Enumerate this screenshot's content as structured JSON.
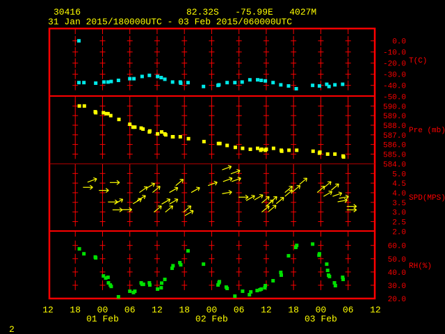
{
  "header": {
    "station": "30416",
    "location": "82.32S   -75.99E   4027M",
    "period": "31 Jan 2015/180000UTC - 03 Feb 2015/060000UTC"
  },
  "footer": {
    "page": "2"
  },
  "colors": {
    "frame": "#ff0000",
    "temperature": "#00e8e8",
    "pressure": "#ffff00",
    "wind": "#ffff00",
    "rh": "#00e000",
    "text": "#ffff00"
  },
  "chart_data": [
    {
      "type": "scatter",
      "title": "Temperature",
      "ylabel": "T(C)",
      "ylim": [
        -50,
        0
      ],
      "yticks": [
        "0.0",
        "-10.0",
        "-20.0",
        "-30.0",
        "-40.0",
        "-50.0"
      ],
      "ytick_values": [
        0,
        -10,
        -20,
        -30,
        -40,
        -50
      ],
      "x_units": "hours since 31 Jan 2015 12UTC",
      "points": [
        [
          6.8,
          0.0
        ],
        [
          6.8,
          -37.5
        ],
        [
          7.9,
          -37.5
        ],
        [
          10.5,
          -38
        ],
        [
          12.3,
          -37
        ],
        [
          13.2,
          -37
        ],
        [
          13.9,
          -36.5
        ],
        [
          15.5,
          -35.5
        ],
        [
          18.0,
          -34
        ],
        [
          18.9,
          -34
        ],
        [
          20.7,
          -32
        ],
        [
          22.3,
          -31
        ],
        [
          24.1,
          -32
        ],
        [
          24.9,
          -33
        ],
        [
          25.7,
          -34.5
        ],
        [
          27.4,
          -37
        ],
        [
          29.1,
          -37
        ],
        [
          29.2,
          -38
        ],
        [
          30.8,
          -37.5
        ],
        [
          34.2,
          -41
        ],
        [
          37.4,
          -40
        ],
        [
          37.6,
          -39.5
        ],
        [
          39.4,
          -37.5
        ],
        [
          41.1,
          -37.5
        ],
        [
          42.7,
          -37
        ],
        [
          44.4,
          -35
        ],
        [
          46.1,
          -35
        ],
        [
          46.9,
          -35.5
        ],
        [
          47.8,
          -36
        ],
        [
          49.5,
          -37.5
        ],
        [
          51.2,
          -39.5
        ],
        [
          52.9,
          -40.5
        ],
        [
          54.6,
          -43
        ],
        [
          58.2,
          -40
        ],
        [
          59.7,
          -40.5
        ],
        [
          61.3,
          -39
        ],
        [
          61.8,
          -41
        ],
        [
          63.1,
          -39.5
        ],
        [
          64.8,
          -39
        ]
      ]
    },
    {
      "type": "scatter",
      "title": "Pressure",
      "ylabel": "Pre (mb)",
      "ylim": [
        584,
        590
      ],
      "yticks": [
        "590.0",
        "589.0",
        "588.0",
        "587.0",
        "586.0",
        "585.0",
        "584.0"
      ],
      "ytick_values": [
        590,
        589,
        588,
        587,
        586,
        585,
        584
      ],
      "points": [
        [
          6.9,
          590.0
        ],
        [
          8.0,
          590.0
        ],
        [
          10.4,
          589.4
        ],
        [
          10.5,
          589.3
        ],
        [
          12.2,
          589.3
        ],
        [
          12.8,
          589.2
        ],
        [
          13.2,
          589.2
        ],
        [
          13.8,
          589.0
        ],
        [
          15.6,
          588.6
        ],
        [
          18.0,
          588.1
        ],
        [
          18.7,
          587.8
        ],
        [
          19.1,
          587.8
        ],
        [
          20.5,
          587.7
        ],
        [
          20.9,
          587.6
        ],
        [
          22.4,
          587.4
        ],
        [
          22.3,
          587.3
        ],
        [
          24.1,
          587.1
        ],
        [
          25.0,
          587.3
        ],
        [
          25.7,
          587.1
        ],
        [
          25.9,
          587.0
        ],
        [
          27.4,
          586.8
        ],
        [
          27.5,
          586.8
        ],
        [
          29.1,
          586.8
        ],
        [
          30.9,
          586.6
        ],
        [
          34.3,
          586.3
        ],
        [
          37.5,
          586.1
        ],
        [
          37.8,
          586.1
        ],
        [
          39.4,
          585.9
        ],
        [
          41.2,
          585.7
        ],
        [
          42.8,
          585.6
        ],
        [
          44.5,
          585.5
        ],
        [
          46.1,
          585.6
        ],
        [
          46.8,
          585.4
        ],
        [
          47.0,
          585.5
        ],
        [
          47.8,
          585.4
        ],
        [
          48.0,
          585.5
        ],
        [
          49.6,
          585.6
        ],
        [
          51.3,
          585.4
        ],
        [
          51.4,
          585.3
        ],
        [
          53.0,
          585.4
        ],
        [
          54.7,
          585.4
        ],
        [
          58.3,
          585.3
        ],
        [
          59.7,
          585.1
        ],
        [
          59.8,
          585.2
        ],
        [
          61.5,
          585.0
        ],
        [
          63.1,
          585.0
        ],
        [
          64.9,
          584.8
        ],
        [
          65.0,
          584.7
        ]
      ]
    },
    {
      "type": "scatter",
      "title": "Wind speed and direction",
      "ylabel": "SPD(MPS)",
      "ylim": [
        2.0,
        5.0
      ],
      "yticks": [
        "5.0",
        "4.5",
        "4.0",
        "3.5",
        "3.0",
        "2.5",
        "2.0"
      ],
      "ytick_values": [
        5.0,
        4.5,
        4.0,
        3.5,
        3.0,
        2.5,
        2.0
      ],
      "points_hour_speed_angle": [
        [
          7.7,
          4.28,
          0
        ],
        [
          8.7,
          4.55,
          20
        ],
        [
          13.6,
          4.53,
          0
        ],
        [
          11.2,
          4.12,
          0
        ],
        [
          13.2,
          3.52,
          0
        ],
        [
          14.6,
          3.41,
          30
        ],
        [
          14.2,
          3.11,
          0
        ],
        [
          16.3,
          3.12,
          0
        ],
        [
          18.7,
          3.43,
          30
        ],
        [
          19.6,
          3.59,
          30
        ],
        [
          20.1,
          4.01,
          35
        ],
        [
          21.6,
          4.23,
          30
        ],
        [
          23.0,
          4.01,
          40
        ],
        [
          23.3,
          2.99,
          40
        ],
        [
          25.0,
          3.41,
          30
        ],
        [
          26.7,
          3.41,
          30
        ],
        [
          25.8,
          2.99,
          40
        ],
        [
          26.7,
          4.01,
          30
        ],
        [
          28.1,
          4.37,
          40
        ],
        [
          29.8,
          2.99,
          40
        ],
        [
          30.1,
          2.81,
          30
        ],
        [
          31.5,
          4.01,
          30
        ],
        [
          35.2,
          4.37,
          20
        ],
        [
          38.3,
          5.19,
          20
        ],
        [
          40.2,
          4.98,
          20
        ],
        [
          38.5,
          4.58,
          20
        ],
        [
          40.4,
          4.58,
          20
        ],
        [
          38.3,
          3.95,
          10
        ],
        [
          41.9,
          3.77,
          0
        ],
        [
          43.6,
          3.59,
          30
        ],
        [
          45.4,
          3.63,
          30
        ],
        [
          47.0,
          3.47,
          40
        ],
        [
          47.9,
          3.29,
          40
        ],
        [
          47.0,
          2.99,
          40
        ],
        [
          48.5,
          3.02,
          40
        ],
        [
          48.7,
          3.47,
          40
        ],
        [
          50.2,
          3.43,
          40
        ],
        [
          52.1,
          4.01,
          40
        ],
        [
          52.1,
          3.81,
          40
        ],
        [
          53.8,
          4.05,
          40
        ],
        [
          55.3,
          4.43,
          40
        ],
        [
          59.2,
          4.01,
          40
        ],
        [
          60.6,
          4.25,
          40
        ],
        [
          60.6,
          3.81,
          30
        ],
        [
          62.3,
          4.13,
          40
        ],
        [
          62.6,
          3.81,
          20
        ],
        [
          64.0,
          3.71,
          10
        ],
        [
          63.7,
          3.53,
          10
        ],
        [
          65.7,
          3.29,
          0
        ],
        [
          65.7,
          3.11,
          0
        ]
      ]
    },
    {
      "type": "scatter",
      "title": "Relative humidity",
      "ylabel": "RH(%)",
      "ylim": [
        20,
        60
      ],
      "yticks": [
        "60.0",
        "50.0",
        "40.0",
        "30.0",
        "20.0"
      ],
      "ytick_values": [
        60,
        50,
        40,
        30,
        20
      ],
      "points": [
        [
          6.9,
          57.4
        ],
        [
          7.9,
          53.7
        ],
        [
          10.4,
          51.3
        ],
        [
          10.5,
          50.6
        ],
        [
          12.2,
          37.0
        ],
        [
          12.7,
          35.4
        ],
        [
          13.2,
          36.0
        ],
        [
          13.3,
          31.8
        ],
        [
          13.7,
          30.2
        ],
        [
          13.9,
          29.1
        ],
        [
          15.5,
          21.3
        ],
        [
          18.0,
          25.5
        ],
        [
          18.8,
          24.5
        ],
        [
          19.1,
          25.5
        ],
        [
          20.5,
          31.8
        ],
        [
          20.7,
          30.7
        ],
        [
          21.0,
          30.7
        ],
        [
          22.3,
          31.8
        ],
        [
          22.4,
          30.2
        ],
        [
          24.1,
          27.1
        ],
        [
          24.9,
          28.1
        ],
        [
          25.0,
          31.6
        ],
        [
          25.7,
          34.4
        ],
        [
          27.3,
          42.8
        ],
        [
          27.5,
          44.7
        ],
        [
          29.0,
          47.0
        ],
        [
          29.2,
          45.4
        ],
        [
          30.8,
          55.9
        ],
        [
          34.2,
          45.9
        ],
        [
          37.4,
          30.2
        ],
        [
          37.6,
          31.8
        ],
        [
          37.7,
          32.7
        ],
        [
          39.2,
          28.6
        ],
        [
          39.4,
          27.6
        ],
        [
          41.1,
          21.8
        ],
        [
          42.8,
          25.5
        ],
        [
          44.3,
          22.9
        ],
        [
          44.6,
          25.0
        ],
        [
          46.0,
          26.0
        ],
        [
          46.6,
          26.6
        ],
        [
          46.9,
          27.1
        ],
        [
          47.7,
          28.1
        ],
        [
          47.8,
          29.7
        ],
        [
          49.5,
          33.4
        ],
        [
          51.2,
          39.7
        ],
        [
          51.3,
          37.6
        ],
        [
          52.9,
          52.2
        ],
        [
          54.5,
          58.5
        ],
        [
          54.7,
          60.0
        ],
        [
          58.2,
          61.0
        ],
        [
          59.6,
          52.6
        ],
        [
          59.7,
          53.7
        ],
        [
          61.3,
          45.9
        ],
        [
          61.5,
          41.2
        ],
        [
          61.7,
          37.6
        ],
        [
          61.9,
          36.6
        ],
        [
          63.0,
          31.8
        ],
        [
          63.2,
          29.7
        ],
        [
          64.8,
          36.0
        ],
        [
          64.9,
          34.4
        ]
      ]
    }
  ],
  "xaxis": {
    "xlim_hours": [
      0,
      72
    ],
    "tick_labels": [
      "12",
      "18",
      "00",
      "06",
      "12",
      "18",
      "00",
      "06",
      "12",
      "18",
      "00",
      "06",
      "12"
    ],
    "day_labels": [
      "01 Feb",
      "02 Feb",
      "03 Feb"
    ]
  }
}
